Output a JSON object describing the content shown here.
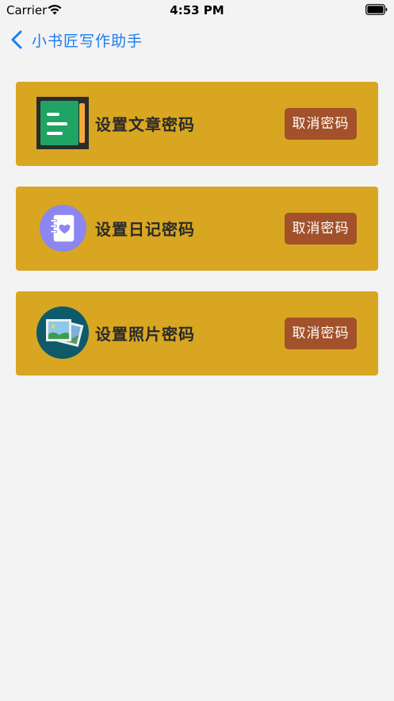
{
  "status_bar": {
    "carrier": "Carrier",
    "time": "4:53 PM"
  },
  "nav": {
    "back_label": "小书匠写作助手"
  },
  "cards": [
    {
      "label": "设置文章密码",
      "button": "取消密码",
      "icon": "article-icon"
    },
    {
      "label": "设置日记密码",
      "button": "取消密码",
      "icon": "diary-icon"
    },
    {
      "label": "设置照片密码",
      "button": "取消密码",
      "icon": "photo-icon"
    }
  ],
  "colors": {
    "card_bg": "#d8a621",
    "button_bg": "#a2512a",
    "link": "#1a7df0",
    "page_bg": "#f3f3f3"
  }
}
